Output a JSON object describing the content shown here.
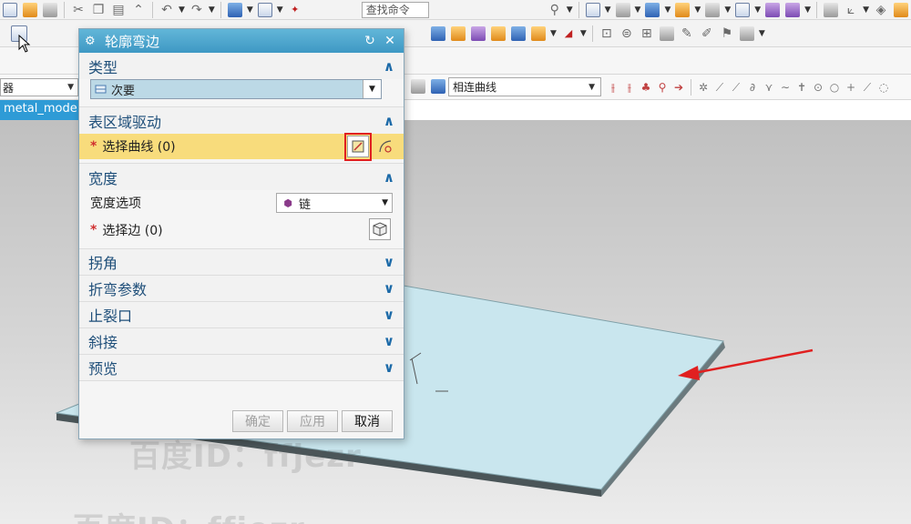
{
  "toolbar": {
    "command_search_placeholder": "查找命令",
    "filter_value": "器",
    "curve_rule_value": "相连曲线"
  },
  "document_tab": {
    "label": "metal_mode"
  },
  "dialog": {
    "title": "轮廓弯边",
    "sections": {
      "type": {
        "header": "类型",
        "value": "次要"
      },
      "surface_region_drive": {
        "header": "表区域驱动",
        "select_curve_label": "选择曲线 (0)"
      },
      "width": {
        "header": "宽度",
        "width_option_label": "宽度选项",
        "width_option_value": "链",
        "select_edge_label": "选择边 (0)"
      },
      "corner": {
        "header": "拐角"
      },
      "bend_params": {
        "header": "折弯参数"
      },
      "relief": {
        "header": "止裂口"
      },
      "miter": {
        "header": "斜接"
      },
      "preview": {
        "header": "预览"
      }
    },
    "buttons": {
      "ok": "确定",
      "apply": "应用",
      "cancel": "取消"
    },
    "chevron_expanded": "^",
    "chevron_collapsed": "v"
  },
  "watermarks": [
    "百度ID：ffjezr",
    "百度ID：ffjezr"
  ],
  "colors": {
    "title_bar": "#3e98c4",
    "highlight_row": "#f8dc7c",
    "annotation_red": "#e02020",
    "plate": "#c9e6ee",
    "tab_blue": "#2e9bd6"
  }
}
